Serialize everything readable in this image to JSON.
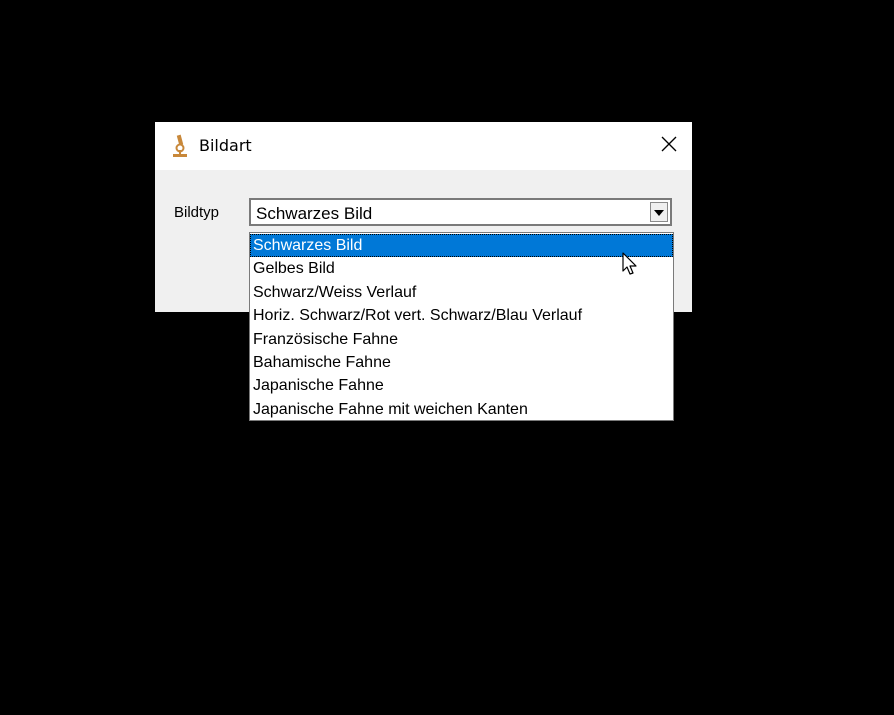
{
  "window": {
    "title": "Bildart",
    "icon": "microscope-icon",
    "close_icon": "close-icon"
  },
  "form": {
    "label": "Bildtyp",
    "combo_value": "Schwarzes Bild"
  },
  "dropdown": {
    "selected_index": 0,
    "options": [
      "Schwarzes Bild",
      "Gelbes Bild",
      "Schwarz/Weiss Verlauf",
      "Horiz. Schwarz/Rot vert. Schwarz/Blau Verlauf",
      "Französische Fahne",
      "Bahamische Fahne",
      "Japanische Fahne",
      "Japanische Fahne mit weichen Kanten"
    ]
  },
  "colors": {
    "background": "#000000",
    "highlight": "#0078d7",
    "dialog": "#f0f0f0"
  }
}
